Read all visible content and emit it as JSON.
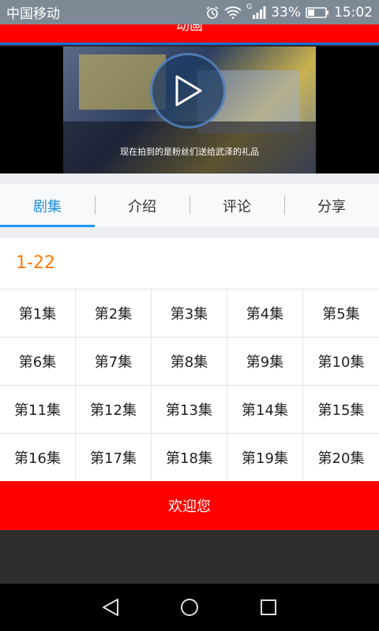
{
  "status": {
    "carrier": "中国移动",
    "network": "G",
    "battery": "33%",
    "time": "15:02"
  },
  "header": {
    "title": "动画"
  },
  "video": {
    "subtitle": "现在拍到的是粉丝们送给武泽的礼品"
  },
  "tabs": [
    {
      "label": "剧集",
      "active": true
    },
    {
      "label": "介绍",
      "active": false
    },
    {
      "label": "评论",
      "active": false
    },
    {
      "label": "分享",
      "active": false
    }
  ],
  "episodes": {
    "range": "1-22",
    "items": [
      "第1集",
      "第2集",
      "第3集",
      "第4集",
      "第5集",
      "第6集",
      "第7集",
      "第8集",
      "第9集",
      "第10集",
      "第11集",
      "第12集",
      "第13集",
      "第14集",
      "第15集",
      "第16集",
      "第17集",
      "第18集",
      "第19集",
      "第20集"
    ]
  },
  "footer": {
    "welcome": "欢迎您"
  },
  "colors": {
    "accent": "#ff0000",
    "tab_active": "#1e90d8",
    "range": "#ff7a00"
  }
}
